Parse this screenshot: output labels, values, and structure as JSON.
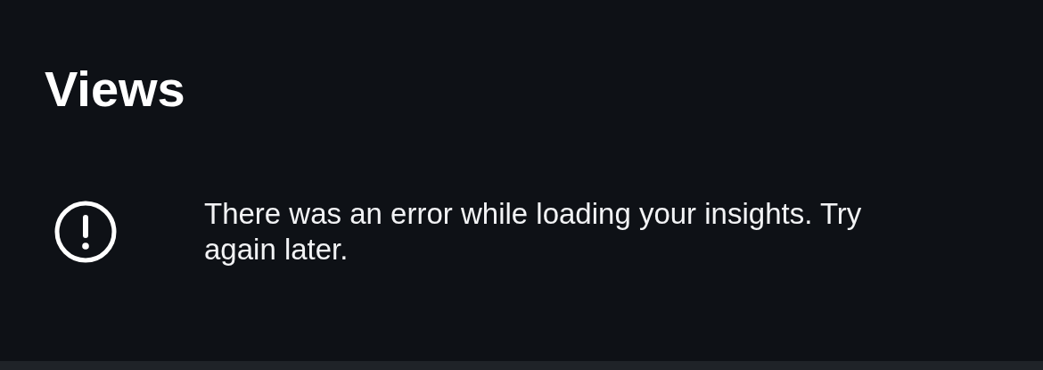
{
  "title": "Views",
  "error": {
    "message": "There was an error while loading your insights. Try again later."
  }
}
